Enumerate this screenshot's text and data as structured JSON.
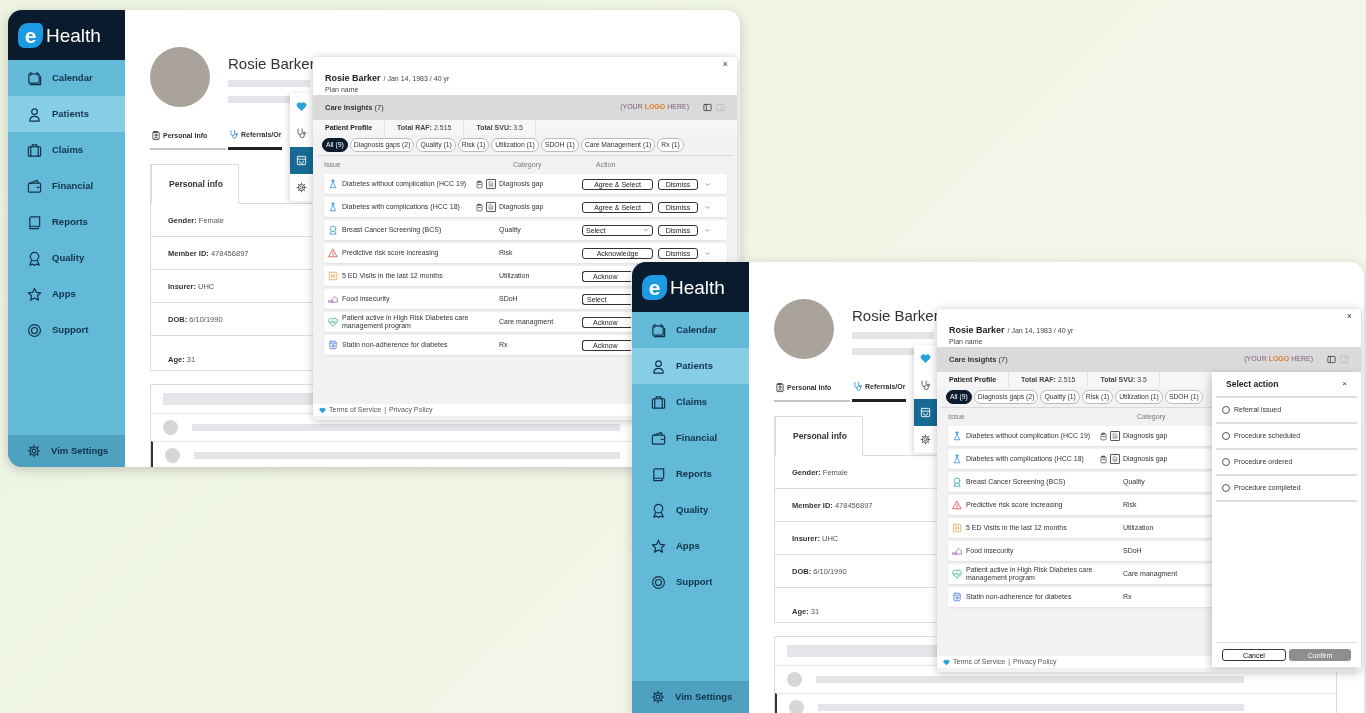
{
  "windows": [
    {
      "sidebar": {
        "logo": {
          "mark": "e",
          "text": "Health"
        },
        "items": [
          {
            "kind": "calendar",
            "label": "Calendar",
            "selected": false
          },
          {
            "kind": "person",
            "label": "Patients",
            "selected": true
          },
          {
            "kind": "briefcase",
            "label": "Claims",
            "selected": false
          },
          {
            "kind": "wallet",
            "label": "Financial",
            "selected": false
          },
          {
            "kind": "reports",
            "label": "Reports",
            "selected": false
          },
          {
            "kind": "award",
            "label": "Quality",
            "selected": false
          },
          {
            "kind": "star",
            "label": "Apps",
            "selected": false
          },
          {
            "kind": "support",
            "label": "Support",
            "selected": false
          }
        ],
        "footer": {
          "label": "Vim Settings"
        }
      },
      "patient": {
        "name": "Rosie Barker"
      },
      "tabs": [
        {
          "kind": "idbadge",
          "label": "Personal Info",
          "selected": false
        },
        {
          "kind": "stethoscope",
          "label": "Referrals/Or",
          "selected": true
        }
      ],
      "tool_strip": [
        {
          "kind": "heart",
          "selected": false
        },
        {
          "kind": "stethoscope",
          "selected": false
        },
        {
          "kind": "inbox",
          "selected": true
        },
        {
          "kind": "gear",
          "selected": false
        }
      ],
      "personal_info": {
        "title": "Personal info",
        "rows": [
          "**Gender:** Female",
          "**Member ID:** 478456897",
          "**Insurer:** UHC",
          "**DOB:** 6/10/1990",
          "**Age:** 31"
        ]
      },
      "popup": {
        "name": "Rosie Barker",
        "subtitle": "/ Jan 14, 1983 / 40 yr",
        "plan": "Plan name",
        "close": "×",
        "insights_title": "**Care Insights** (7)",
        "logo_placeholder": {
          "before": "(YOUR ",
          "highlight": "LOGO",
          "after": " HERE)"
        },
        "profile": {
          "title": "Patient Profile",
          "stats": [
            "**Total RAF:** 2.515",
            "**Total SVU:** 3.5"
          ]
        },
        "chips": [
          {
            "label": "All (9)",
            "selected": true
          },
          {
            "label": "Diagnosis gaps (2)",
            "selected": false
          },
          {
            "label": "Quality (1)",
            "selected": false
          },
          {
            "label": "Risk (1)",
            "selected": false
          },
          {
            "label": "Utilization (1)",
            "selected": false
          },
          {
            "label": "SDOH (1)",
            "selected": false
          },
          {
            "label": "Care Management (1)",
            "selected": false
          },
          {
            "label": "Rx (1)",
            "selected": false
          }
        ],
        "columns": [
          "Issue",
          "Category",
          "Action"
        ],
        "rows": [
          {
            "kind": "hcc",
            "issue": "Diabetes without complication (HCC 19)",
            "evidence": true,
            "category": "Diagnosis gap",
            "actions": [
              {
                "kind": "button",
                "label": "Agree & Select"
              },
              {
                "kind": "button",
                "label": "Dismiss"
              }
            ],
            "menu_caret": true
          },
          {
            "kind": "hcc",
            "issue": "Diabetes with complications (HCC 18)",
            "evidence": true,
            "category": "Diagnosis gap",
            "actions": [
              {
                "kind": "button",
                "label": "Agree & Select"
              },
              {
                "kind": "button",
                "label": "Dismiss"
              }
            ],
            "menu_caret": true
          },
          {
            "kind": "quality",
            "issue": "Breast Cancer Screening (BCS)",
            "evidence": false,
            "category": "Quality",
            "actions": [
              {
                "kind": "select",
                "label": "Select"
              },
              {
                "kind": "button",
                "label": "Dismiss"
              }
            ],
            "menu_caret": true
          },
          {
            "kind": "risk",
            "issue": "Predictive risk score increasing",
            "evidence": false,
            "category": "Risk",
            "actions": [
              {
                "kind": "button",
                "label": "Acknowledge"
              },
              {
                "kind": "button",
                "label": "Dismiss"
              }
            ],
            "menu_caret": true
          },
          {
            "kind": "utilization",
            "issue": "5 ED Visits in the last 12 months",
            "evidence": false,
            "category": "Utilization",
            "actions": [
              {
                "kind": "partial-button",
                "label": "Acknow"
              }
            ],
            "menu_caret": false
          },
          {
            "kind": "food",
            "issue": "Food insecurity",
            "evidence": false,
            "category": "SDoH",
            "actions": [
              {
                "kind": "partial-select",
                "label": "Select"
              }
            ],
            "menu_caret": false
          },
          {
            "kind": "care",
            "issue": "Patient active in High Risk Diabetes care management program",
            "evidence": false,
            "category": "Care managment",
            "actions": [
              {
                "kind": "partial-button",
                "label": "Acknow"
              }
            ],
            "menu_caret": false
          },
          {
            "kind": "rx",
            "issue": "Statin non-adherence for diabetes",
            "evidence": false,
            "category": "Rx",
            "actions": [
              {
                "kind": "partial-button",
                "label": "Acknow"
              }
            ],
            "menu_caret": false
          }
        ],
        "footer": {
          "terms": "Terms of Service",
          "separator": "|",
          "privacy": "Privacy Policy"
        }
      }
    },
    {
      "sidebar": {
        "logo": {
          "mark": "e",
          "text": "Health"
        },
        "items": [
          {
            "kind": "calendar",
            "label": "Calendar",
            "selected": false
          },
          {
            "kind": "person",
            "label": "Patients",
            "selected": true
          },
          {
            "kind": "briefcase",
            "label": "Claims",
            "selected": false
          },
          {
            "kind": "wallet",
            "label": "Financial",
            "selected": false
          },
          {
            "kind": "reports",
            "label": "Reports",
            "selected": false
          },
          {
            "kind": "award",
            "label": "Quality",
            "selected": false
          },
          {
            "kind": "star",
            "label": "Apps",
            "selected": false
          },
          {
            "kind": "support",
            "label": "Support",
            "selected": false
          }
        ],
        "footer": {
          "label": "Vim Settings"
        }
      },
      "patient": {
        "name": "Rosie Barker"
      },
      "tabs": [
        {
          "kind": "idbadge",
          "label": "Personal Info",
          "selected": false
        },
        {
          "kind": "stethoscope",
          "label": "Referrals/Or",
          "selected": true
        }
      ],
      "tool_strip": [
        {
          "kind": "heart",
          "selected": false
        },
        {
          "kind": "stethoscope",
          "selected": false
        },
        {
          "kind": "inbox",
          "selected": true
        },
        {
          "kind": "gear",
          "selected": false
        }
      ],
      "personal_info": {
        "title": "Personal info",
        "rows": [
          "**Gender:** Female",
          "**Member ID:** 478456897",
          "**Insurer:** UHC",
          "**DOB:** 6/10/1990",
          "**Age:** 31"
        ]
      },
      "popup": {
        "name": "Rosie Barker",
        "subtitle": "/ Jan 14, 1983 / 40 yr",
        "plan": "Plan name",
        "close": "×",
        "insights_title": "**Care Insights** (7)",
        "logo_placeholder": {
          "before": "(YOUR ",
          "highlight": "LOGO",
          "after": " HERE)"
        },
        "profile": {
          "title": "Patient Profile",
          "stats": [
            "**Total RAF:** 2.515",
            "**Total SVU:** 3.5"
          ]
        },
        "chips": [
          {
            "label": "All (9)",
            "selected": true
          },
          {
            "label": "Diagnosis gaps (2)",
            "selected": false
          },
          {
            "label": "Quality (1)",
            "selected": false
          },
          {
            "label": "Risk (1)",
            "selected": false
          },
          {
            "label": "Utilization (1)",
            "selected": false
          },
          {
            "label": "SDOH (1)",
            "selected": false
          }
        ],
        "columns": [
          "Issue",
          "Category"
        ],
        "rows": [
          {
            "kind": "hcc",
            "issue": "Diabetes without complication (HCC 19)",
            "evidence": true,
            "category": "Diagnosis gap"
          },
          {
            "kind": "hcc",
            "issue": "Diabetes with complications (HCC 18)",
            "evidence": true,
            "category": "Diagnosis gap"
          },
          {
            "kind": "quality",
            "issue": "Breast Cancer Screening (BCS)",
            "evidence": false,
            "category": "Quality"
          },
          {
            "kind": "risk",
            "issue": "Predictive risk score increasing",
            "evidence": false,
            "category": "Risk"
          },
          {
            "kind": "utilization",
            "issue": "5 ED Visits in the last 12 months",
            "evidence": false,
            "category": "Utilization"
          },
          {
            "kind": "food",
            "issue": "Food insecurity",
            "evidence": false,
            "category": "SDoH"
          },
          {
            "kind": "care",
            "issue": "Patient active in High Risk Diabetes care management program",
            "evidence": false,
            "category": "Care managment"
          },
          {
            "kind": "rx",
            "issue": "Statin non-adherence for diabetes",
            "evidence": false,
            "category": "Rx"
          }
        ],
        "footer": {
          "terms": "Terms of Service",
          "separator": "|",
          "privacy": "Privacy Policy"
        },
        "select_action": {
          "title": "Select action",
          "close": "×",
          "options": [
            {
              "label": "Referral issued",
              "checked": false
            },
            {
              "label": "Procedure scheduled",
              "checked": false
            },
            {
              "label": "Procedure ordered",
              "checked": false
            },
            {
              "label": "Procedure completed",
              "checked": false
            }
          ],
          "cancel": "Cancel",
          "confirm": {
            "label": "Confirm",
            "disabled": true
          }
        }
      }
    }
  ]
}
